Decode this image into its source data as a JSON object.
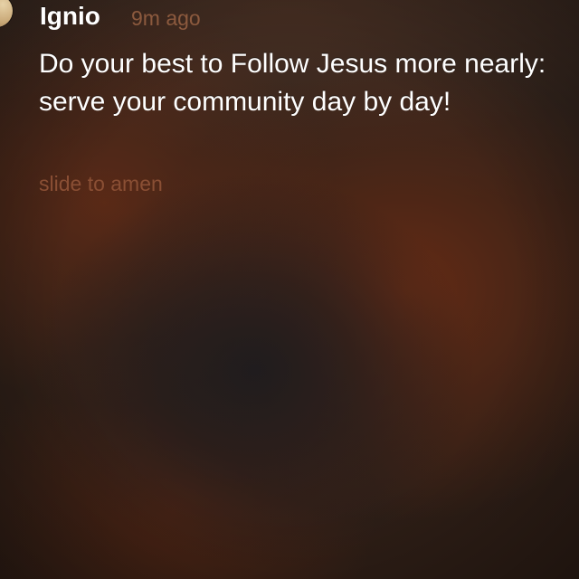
{
  "notification": {
    "sender": "Ignio",
    "time": "9m ago",
    "message": "Do your best to Follow Jesus more nearly: serve your community day by day!",
    "action_hint": "slide to amen"
  },
  "colors": {
    "text_primary": "#ffffff",
    "time_color": "#8c5a3e",
    "hint_color": "#8a4f34",
    "background": "#2a1f1a"
  },
  "icons": {
    "avatar": "app-icon-avatar"
  }
}
